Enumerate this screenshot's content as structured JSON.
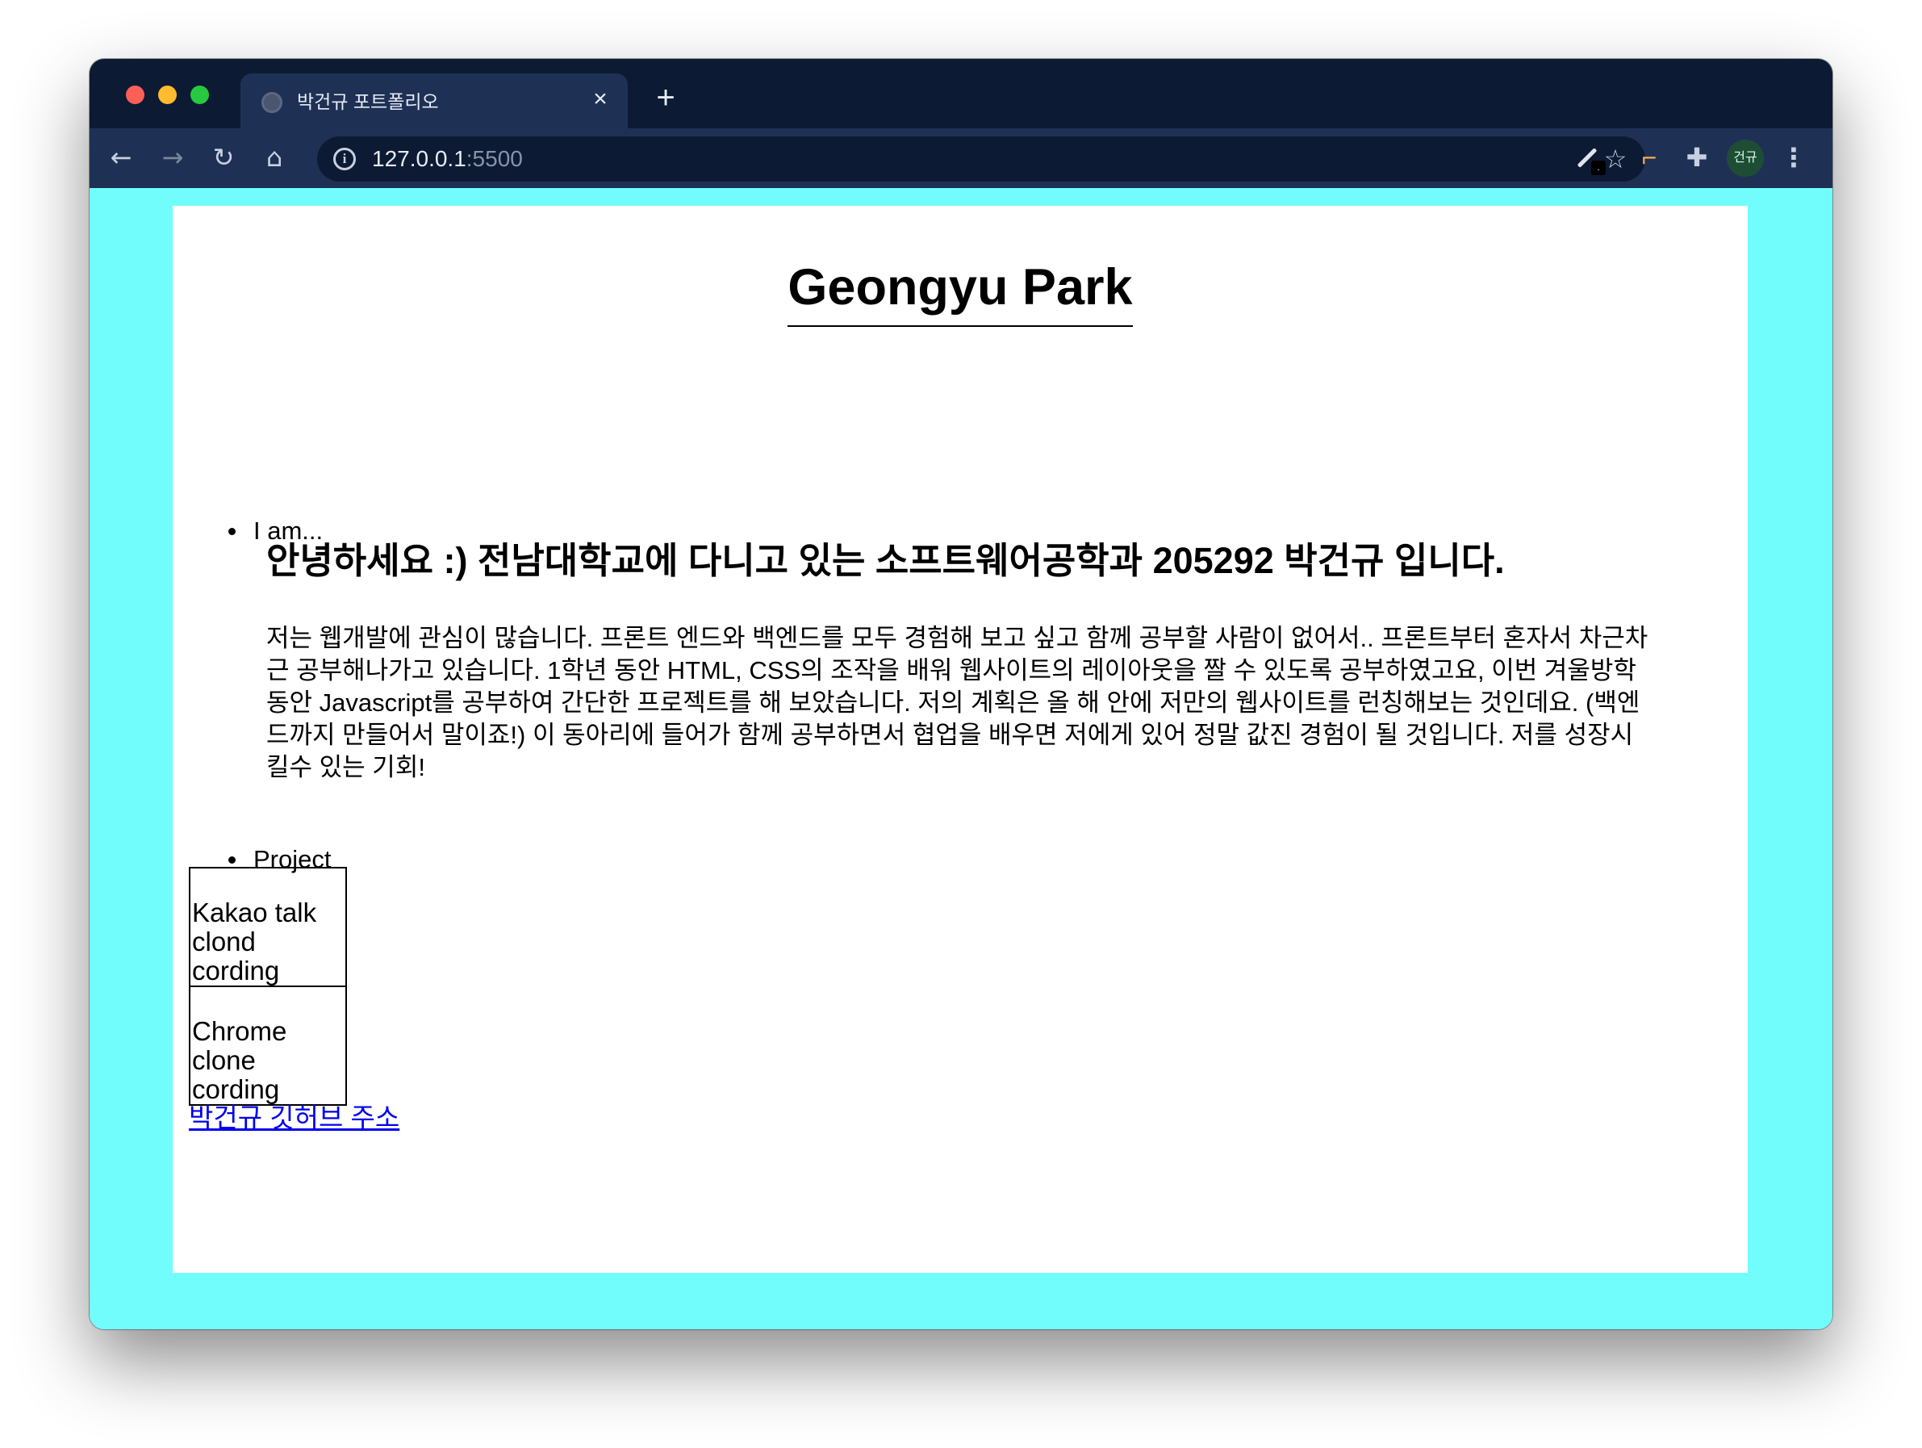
{
  "browser": {
    "tab_title": "박건규 포트폴리오",
    "tab_close": "×",
    "new_tab": "+",
    "url_host": "127.0.0.1",
    "url_port": ":5500",
    "profile_initials": "건규",
    "icons": {
      "back": "arrow-left-icon",
      "forward": "arrow-right-icon",
      "reload": "reload-icon",
      "home": "home-icon",
      "site_info": "info-icon",
      "bookmark": "star-icon",
      "extensions": "puzzle-icon",
      "menu": "kebab-menu-icon"
    }
  },
  "page": {
    "title": "Geongyu Park",
    "sections": [
      {
        "label": "I am..."
      },
      {
        "label": "Project"
      }
    ],
    "intro": {
      "heading": "안녕하세요 :) 전남대학교에 다니고 있는 소프트웨어공학과 205292 박건규 입니다.",
      "body": "저는 웹개발에 관심이 많습니다. 프론트 엔드와 백엔드를 모두 경험해 보고 싶고 함께 공부할 사람이 없어서.. 프론트부터 혼자서 차근차근 공부해나가고 있습니다. 1학년 동안 HTML, CSS의 조작을 배워 웹사이트의 레이아웃을 짤 수 있도록 공부하였고요, 이번 겨울방학동안 Javascript를 공부하여 간단한 프로젝트를 해 보았습니다. 저의 계획은 올 해 안에 저만의 웹사이트를 런칭해보는 것인데요. (백엔드까지 만들어서 말이죠!) 이 동아리에 들어가 함께 공부하면서 협업을 배우면 저에게 있어 정말 값진 경험이 될 것입니다. 저를 성장시킬수 있는 기회!"
    },
    "projects": [
      {
        "label": "Kakao talk clond cording"
      },
      {
        "label": "Chrome clone cording"
      }
    ],
    "github_link": "박건규 깃허브 주소"
  },
  "colors": {
    "page_background": "#72fdfd",
    "browser_frame": "#0d1a33",
    "browser_toolbar": "#1e3155",
    "link": "#0000ee"
  }
}
